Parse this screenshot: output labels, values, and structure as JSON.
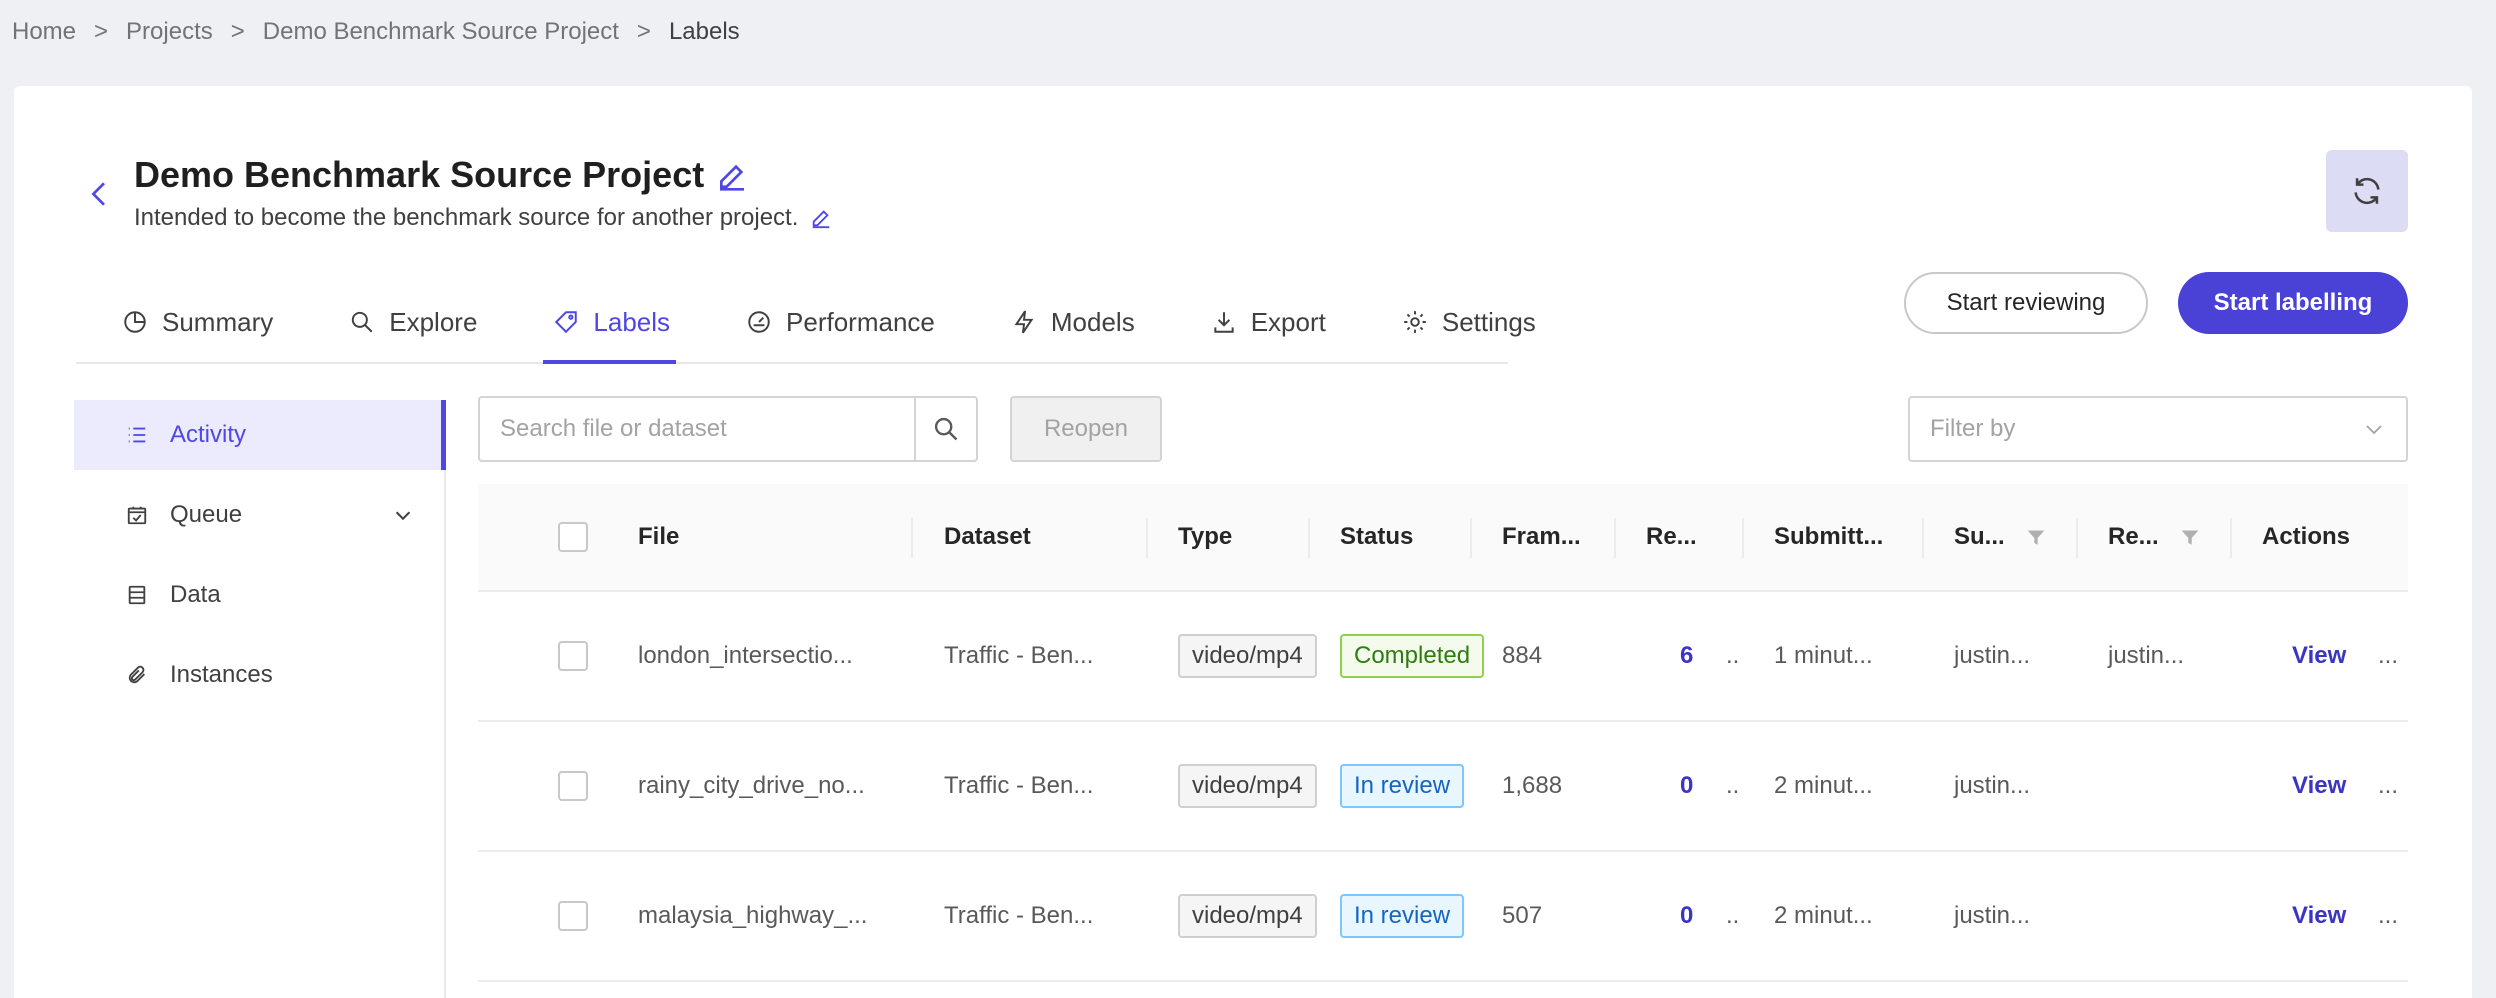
{
  "breadcrumb": {
    "items": [
      "Home",
      "Projects",
      "Demo Benchmark Source Project",
      "Labels"
    ],
    "separator": ">"
  },
  "project": {
    "title": "Demo Benchmark Source Project",
    "description": "Intended to become the benchmark source for another project."
  },
  "tabs": [
    {
      "label": "Summary",
      "icon": "pie-chart-icon"
    },
    {
      "label": "Explore",
      "icon": "search-icon"
    },
    {
      "label": "Labels",
      "icon": "tag-icon",
      "active": true
    },
    {
      "label": "Performance",
      "icon": "gauge-icon"
    },
    {
      "label": "Models",
      "icon": "lightning-icon"
    },
    {
      "label": "Export",
      "icon": "download-icon"
    },
    {
      "label": "Settings",
      "icon": "gear-icon"
    }
  ],
  "actions": {
    "start_reviewing": "Start reviewing",
    "start_labelling": "Start labelling"
  },
  "sidenav": [
    {
      "label": "Activity",
      "icon": "list-icon",
      "active": true
    },
    {
      "label": "Queue",
      "icon": "calendar-check-icon",
      "expandable": true
    },
    {
      "label": "Data",
      "icon": "database-icon"
    },
    {
      "label": "Instances",
      "icon": "paperclip-icon"
    }
  ],
  "toolbar": {
    "search_placeholder": "Search file or dataset",
    "reopen_label": "Reopen",
    "filter_placeholder": "Filter by"
  },
  "table": {
    "columns": [
      "File",
      "Dataset",
      "Type",
      "Status",
      "Fram...",
      "Re...",
      "Submitt...",
      "Su...",
      "Re...",
      "Actions"
    ],
    "rows": [
      {
        "file": "london_intersectio...",
        "dataset": "Traffic - Ben...",
        "type": "video/mp4",
        "status": "Completed",
        "frames": "884",
        "reviews": "6",
        "ellipsis": "..",
        "submitted": "1 minut...",
        "submitter": "justin...",
        "reviewer": "justin...",
        "action": "View",
        "more": "..."
      },
      {
        "file": "rainy_city_drive_no...",
        "dataset": "Traffic - Ben...",
        "type": "video/mp4",
        "status": "In review",
        "frames": "1,688",
        "reviews": "0",
        "ellipsis": "..",
        "submitted": "2 minut...",
        "submitter": "justin...",
        "reviewer": "",
        "action": "View",
        "more": "..."
      },
      {
        "file": "malaysia_highway_...",
        "dataset": "Traffic - Ben...",
        "type": "video/mp4",
        "status": "In review",
        "frames": "507",
        "reviews": "0",
        "ellipsis": "..",
        "submitted": "2 minut...",
        "submitter": "justin...",
        "reviewer": "",
        "action": "View",
        "more": "..."
      }
    ]
  },
  "colors": {
    "accent": "#4f46e5",
    "primary_button": "#4a41d6",
    "completed": "#2f7d12",
    "in_review": "#1565c0"
  }
}
